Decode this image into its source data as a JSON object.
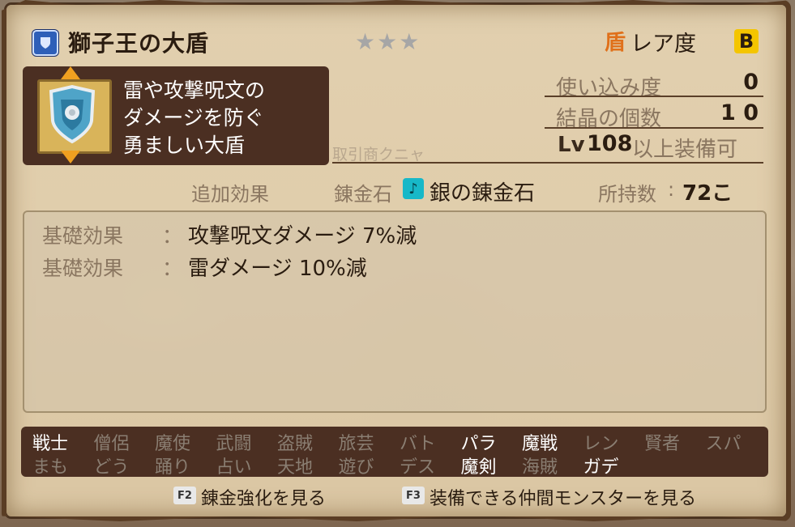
{
  "header": {
    "item_name": "獅子王の大盾",
    "stars": "★★★",
    "rarity_icon": "盾",
    "rarity_label": "レア度",
    "rarity_grade": "B"
  },
  "description": {
    "line1": "雷や攻撃呪文の",
    "line2": "ダメージを防ぐ",
    "line3": "勇ましい大盾"
  },
  "stats": {
    "usage_label": "使い込み度",
    "usage_value": "0",
    "crystal_label": "結晶の個数",
    "crystal_value": "1 0",
    "level_prefix": "Lv",
    "level_value": "108",
    "level_suffix": "以上装備可"
  },
  "ghost_text": "取引商クニャ",
  "alchemy": {
    "extra_label": "追加効果",
    "stone_label": "錬金石",
    "stone_name": "銀の錬金石",
    "owned_label": "所持数",
    "owned_value": "72こ"
  },
  "effects": [
    {
      "label": "基礎効果",
      "sep": "：",
      "text": "攻撃呪文ダメージ 7%減"
    },
    {
      "label": "基礎効果",
      "sep": "：",
      "text": "雷ダメージ 10%減"
    }
  ],
  "jobs_row1": [
    {
      "name": "戦士",
      "on": true
    },
    {
      "name": "僧侶",
      "on": false
    },
    {
      "name": "魔使",
      "on": false
    },
    {
      "name": "武闘",
      "on": false
    },
    {
      "name": "盗賊",
      "on": false
    },
    {
      "name": "旅芸",
      "on": false
    },
    {
      "name": "バト",
      "on": false
    },
    {
      "name": "パラ",
      "on": true
    },
    {
      "name": "魔戦",
      "on": true
    },
    {
      "name": "レン",
      "on": false
    },
    {
      "name": "賢者",
      "on": false
    },
    {
      "name": "スパ",
      "on": false
    }
  ],
  "jobs_row2": [
    {
      "name": "まも",
      "on": false
    },
    {
      "name": "どう",
      "on": false
    },
    {
      "name": "踊り",
      "on": false
    },
    {
      "name": "占い",
      "on": false
    },
    {
      "name": "天地",
      "on": false
    },
    {
      "name": "遊び",
      "on": false
    },
    {
      "name": "デス",
      "on": false
    },
    {
      "name": "魔剣",
      "on": true
    },
    {
      "name": "海賊",
      "on": false
    },
    {
      "name": "ガデ",
      "on": true
    }
  ],
  "footer": {
    "f2_key": "F2",
    "f2_label": "錬金強化を見る",
    "f3_key": "F3",
    "f3_label": "装備できる仲間モンスターを見る"
  },
  "colors": {
    "panel_dark": "#4b2f22",
    "accent_orange": "#f0a020",
    "rarity_yellow": "#f4c500",
    "alchemy_cyan": "#17b8c8"
  }
}
